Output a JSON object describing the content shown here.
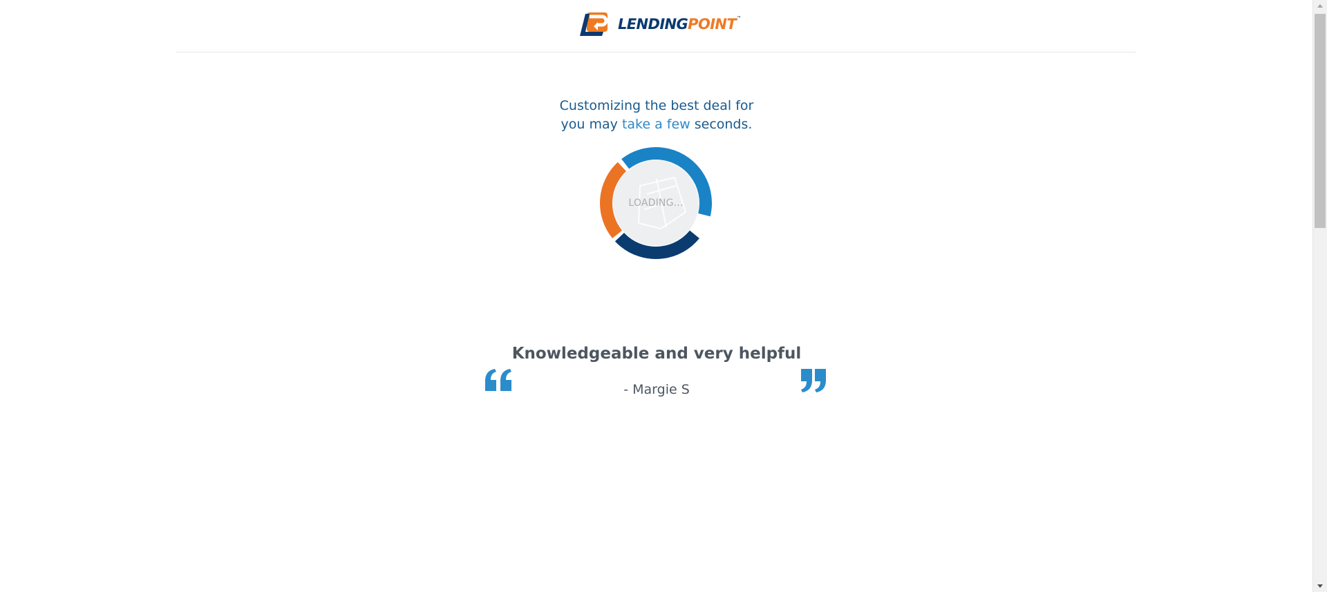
{
  "brand": {
    "name_part1": "LENDING",
    "name_part2": "POINT",
    "trademark": "™",
    "colors": {
      "navy": "#0b3a70",
      "orange": "#ef7a22",
      "blue": "#2f88c6"
    }
  },
  "loading": {
    "message_line1": "Customizing the best deal for",
    "message_line2_part1": "you may ",
    "message_line2_highlight": "take a few",
    "message_line2_part2": " seconds.",
    "label": "LOADING..."
  },
  "testimonial": {
    "quote": "Knowledgeable and very helpful",
    "author": "- Margie S"
  },
  "icons": {
    "logo": "lendingpoint-logo-icon",
    "open_quote": "open-quote-icon",
    "close_quote": "close-quote-icon",
    "scroll_up": "scroll-up-arrow-icon",
    "scroll_down": "scroll-down-arrow-icon"
  }
}
